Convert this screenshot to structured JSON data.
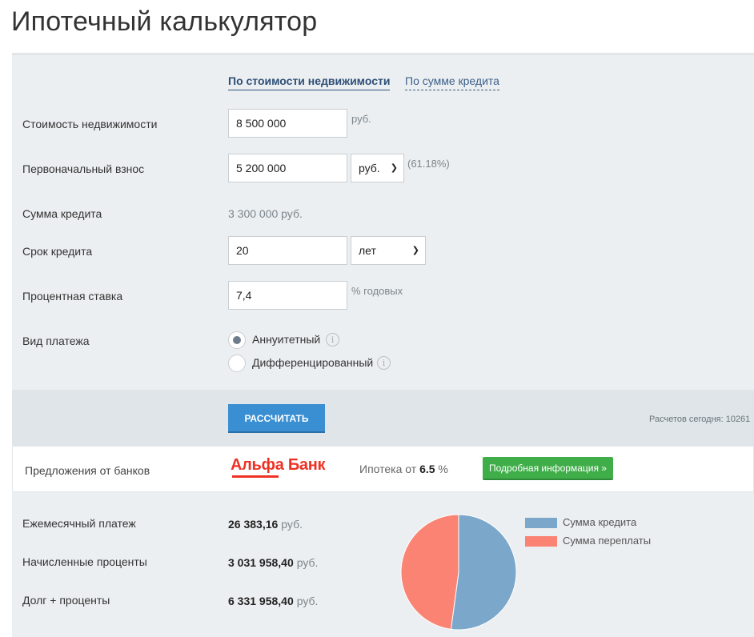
{
  "page": {
    "title": "Ипотечный калькулятор"
  },
  "tabs": [
    {
      "label": "По стоимости недвижимости",
      "active": true
    },
    {
      "label": "По сумме кредита",
      "active": false
    }
  ],
  "form": {
    "property_cost": {
      "label": "Стоимость недвижимости",
      "value": "8 500 000",
      "suffix": "руб."
    },
    "down_payment": {
      "label": "Первоначальный взнос",
      "value": "5 200 000",
      "unit": "руб.",
      "percent": "(61.18%)"
    },
    "loan_amount": {
      "label": "Сумма кредита",
      "value": "3 300 000 руб."
    },
    "term": {
      "label": "Срок кредита",
      "value": "20",
      "unit": "лет"
    },
    "rate": {
      "label": "Процентная ставка",
      "value": "7,4",
      "suffix": "% годовых"
    },
    "payment_type": {
      "label": "Вид платежа",
      "options": [
        {
          "label": "Аннуитетный",
          "checked": true
        },
        {
          "label": "Дифференцированный",
          "checked": false
        }
      ]
    }
  },
  "actions": {
    "calculate_label": "РАССЧИТАТЬ",
    "counter": "Расчетов сегодня: 10261"
  },
  "offers": {
    "label": "Предложения от банков",
    "bank_name": "Альфа Банк",
    "rate_prefix": "Ипотека от",
    "rate_value": "6.5",
    "rate_unit": "%",
    "more_label": "Подробная информация »"
  },
  "results": {
    "monthly": {
      "label": "Ежемесячный платеж",
      "value": "26 383,16",
      "unit": "руб."
    },
    "interest": {
      "label": "Начисленные проценты",
      "value": "3 031 958,40",
      "unit": "руб."
    },
    "total": {
      "label": "Долг + проценты",
      "value": "6 331 958,40",
      "unit": "руб."
    }
  },
  "chart_data": {
    "type": "pie",
    "series": [
      {
        "name": "Сумма кредита",
        "value": 3300000,
        "color": "#7ba7cb"
      },
      {
        "name": "Сумма переплаты",
        "value": 3031958.4,
        "color": "#fa8373"
      }
    ]
  },
  "colors": {
    "accent_blue": "#3a8fd3",
    "offer_green": "#3fae49",
    "bank_red": "#ef3124",
    "panel_bg": "#eceff1"
  }
}
